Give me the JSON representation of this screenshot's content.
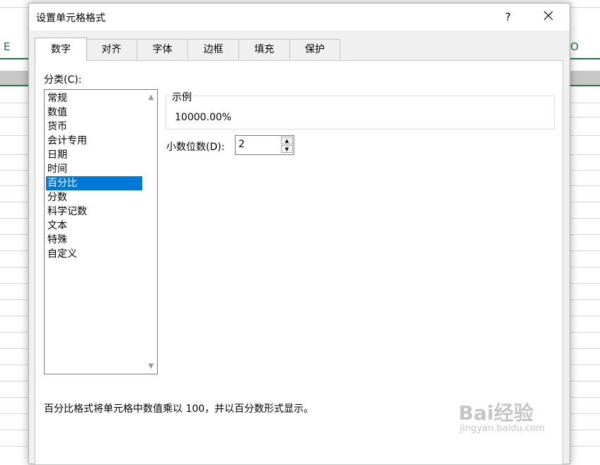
{
  "dialog": {
    "title": "设置单元格格式",
    "help_label": "?",
    "tabs": [
      {
        "label": "数字",
        "active": true
      },
      {
        "label": "对齐"
      },
      {
        "label": "字体"
      },
      {
        "label": "边框"
      },
      {
        "label": "填充"
      },
      {
        "label": "保护"
      }
    ]
  },
  "category": {
    "label": "分类(C):",
    "items": [
      "常规",
      "数值",
      "货币",
      "会计专用",
      "日期",
      "时间",
      "百分比",
      "分数",
      "科学记数",
      "文本",
      "特殊",
      "自定义"
    ],
    "selected": "百分比"
  },
  "sample": {
    "legend": "示例",
    "value": "10000.00%"
  },
  "decimal_places": {
    "label": "小数位数(D):",
    "value": "2"
  },
  "description": "百分比格式将单元格中数值乘以 100，并以百分数形式显示。",
  "sheet": {
    "col_left": "E",
    "col_right": "O"
  },
  "watermark": {
    "text": "Bai经验",
    "sub": "jingyan.baidu.com"
  },
  "colors": {
    "selection": "#0078d7",
    "sheet_accent": "#217346"
  },
  "icons": [
    "close-icon",
    "scroll-up-icon",
    "scroll-down-icon",
    "spin-up-icon",
    "spin-down-icon"
  ]
}
